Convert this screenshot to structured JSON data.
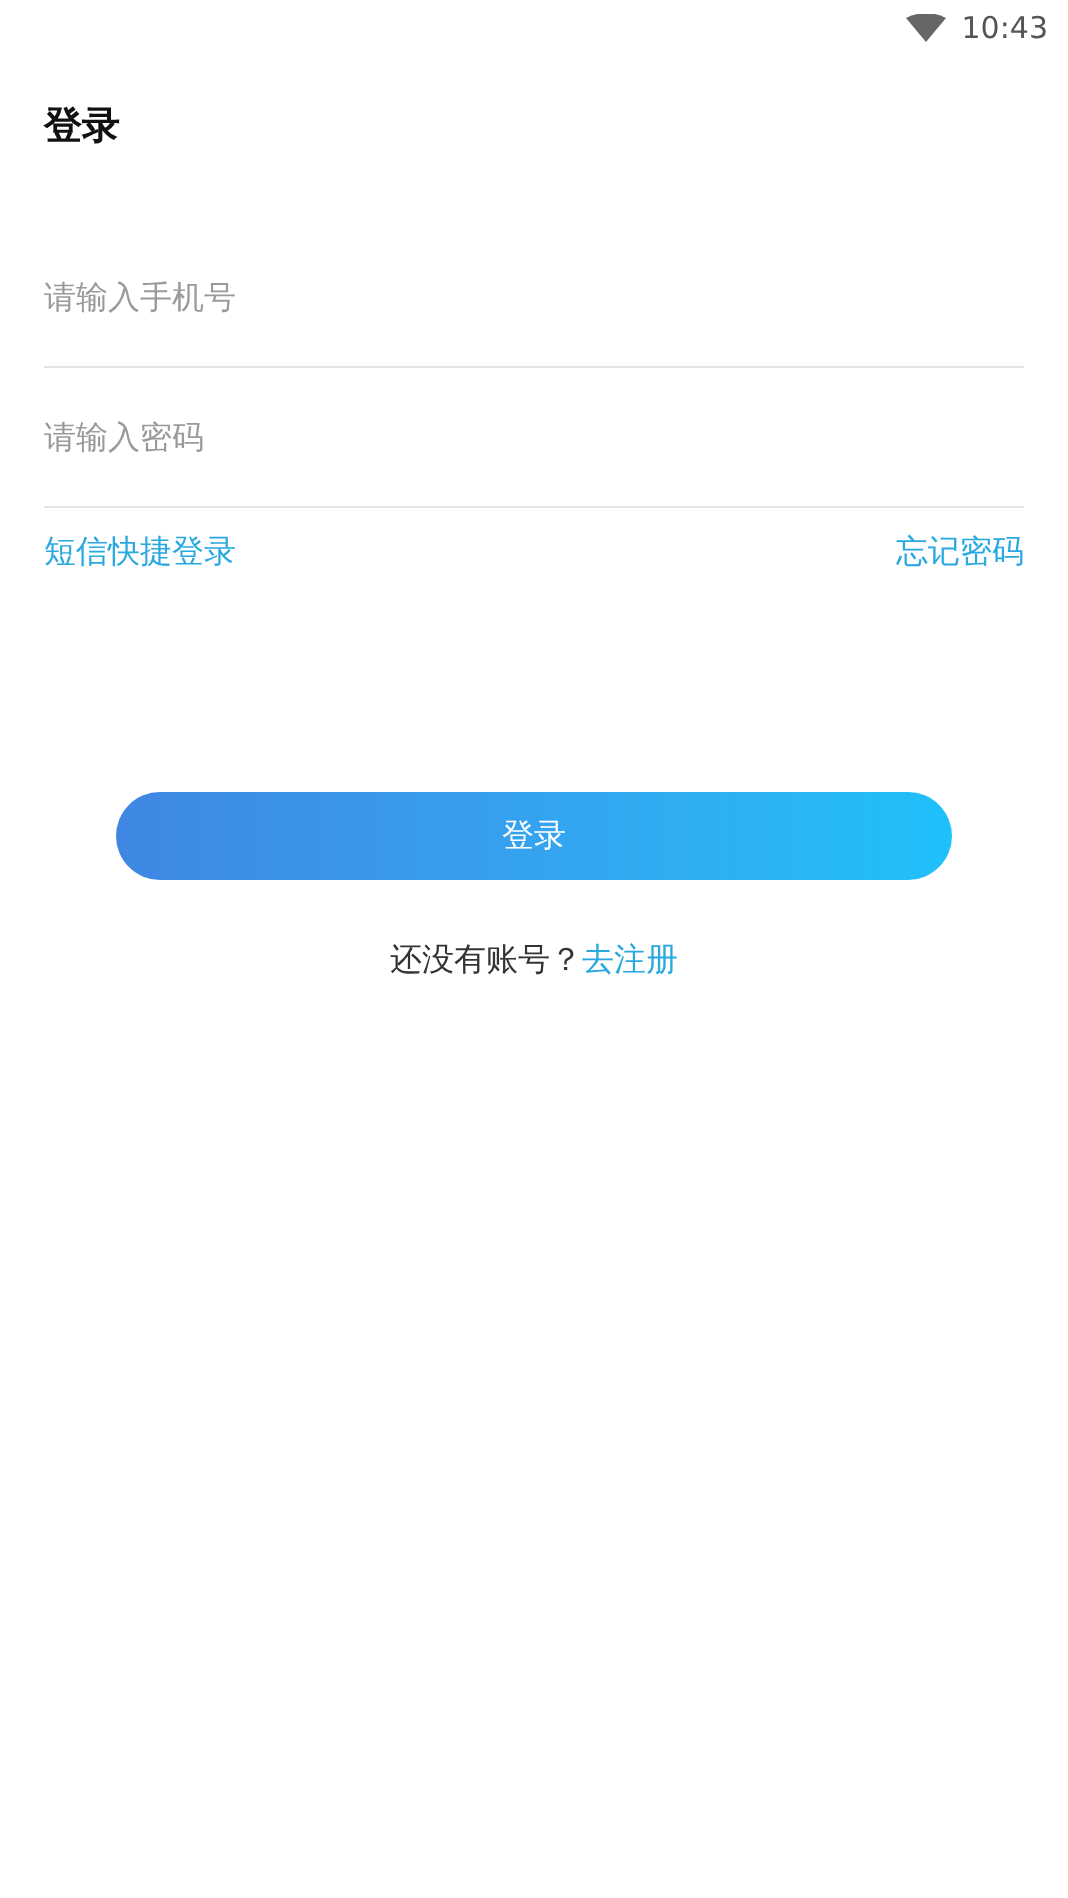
{
  "status_bar": {
    "time": "10:43"
  },
  "title": "登录",
  "fields": [
    {
      "placeholder": "请输入手机号"
    },
    {
      "placeholder": "请输入密码"
    }
  ],
  "links": {
    "sms_login": "短信快捷登录",
    "forgot_password": "忘记密码"
  },
  "login_button": "登录",
  "register_prompt": {
    "text": "还没有账号？",
    "link": "去注册"
  }
}
